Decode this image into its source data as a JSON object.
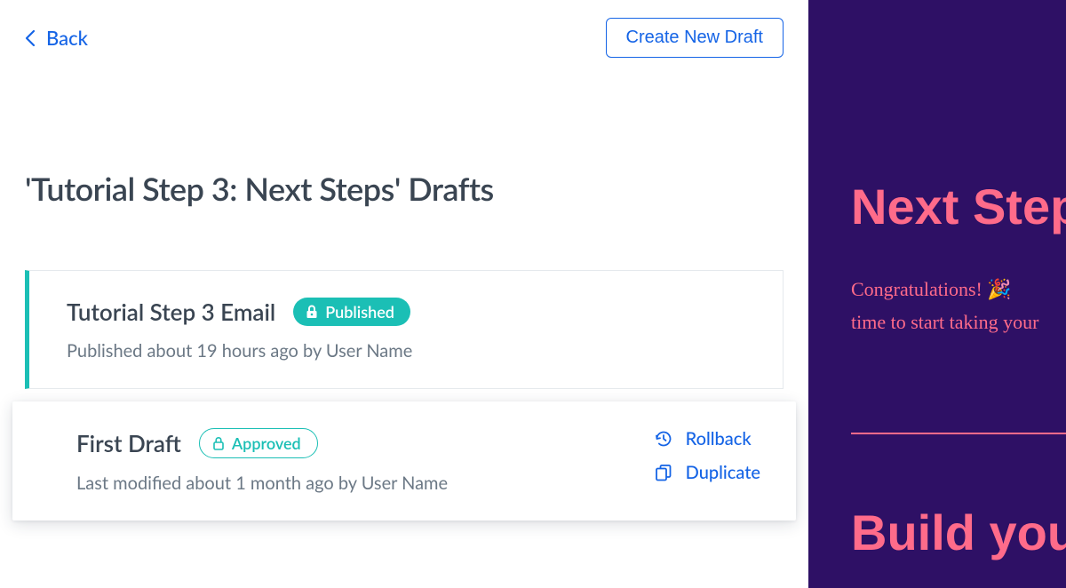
{
  "topbar": {
    "back_label": "Back",
    "create_label": "Create New Draft"
  },
  "page_title": "'Tutorial Step 3: Next Steps' Drafts",
  "drafts": [
    {
      "title": "Tutorial Step 3 Email",
      "badge_label": "Published",
      "badge_style": "solid",
      "subtext": "Published about 19 hours ago by User Name"
    },
    {
      "title": "First Draft",
      "badge_label": "Approved",
      "badge_style": "outline",
      "subtext": "Last modified about 1 month ago by User Name",
      "actions": [
        {
          "icon": "history-icon",
          "label": "Rollback"
        },
        {
          "icon": "duplicate-icon",
          "label": "Duplicate"
        }
      ]
    }
  ],
  "preview": {
    "heading1": "Next Steps",
    "body_line1": "Congratulations! 🎉",
    "body_line2": "time to start taking your",
    "heading2": "Build your"
  },
  "colors": {
    "accent_link": "#1564e6",
    "teal": "#1bbfb5",
    "preview_bg": "#2e1065",
    "preview_fg": "#ff6b8a"
  }
}
